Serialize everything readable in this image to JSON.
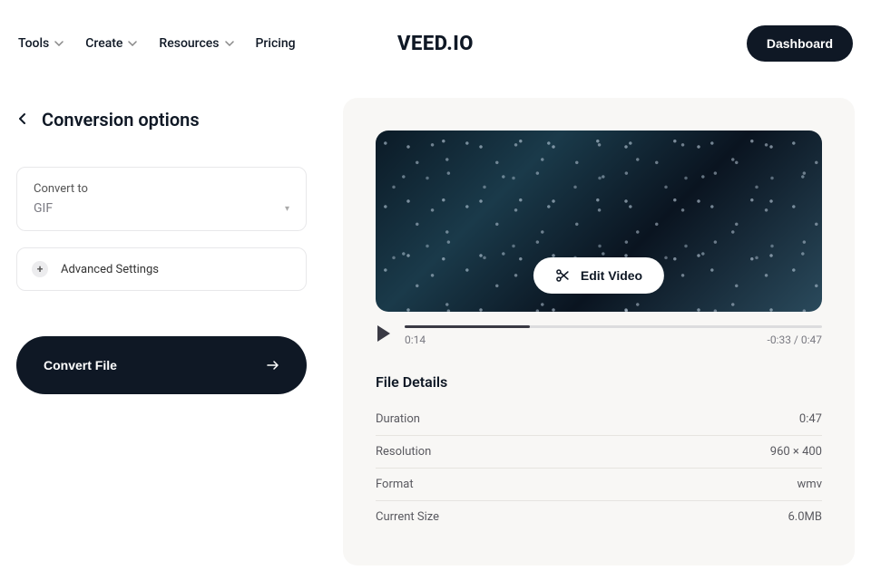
{
  "header": {
    "nav": [
      {
        "label": "Tools",
        "has_dropdown": true
      },
      {
        "label": "Create",
        "has_dropdown": true
      },
      {
        "label": "Resources",
        "has_dropdown": true
      },
      {
        "label": "Pricing",
        "has_dropdown": false
      }
    ],
    "logo": "VEED.IO",
    "dashboard_label": "Dashboard"
  },
  "left": {
    "page_title": "Conversion options",
    "convert_to_label": "Convert to",
    "convert_to_value": "GIF",
    "advanced_label": "Advanced Settings",
    "convert_button_label": "Convert File"
  },
  "right": {
    "edit_video_label": "Edit Video",
    "player": {
      "current_time": "0:14",
      "remaining_and_total": "-0:33 / 0:47",
      "progress_percent": 30
    },
    "details_title": "File Details",
    "details": [
      {
        "label": "Duration",
        "value": "0:47"
      },
      {
        "label": "Resolution",
        "value": "960 × 400"
      },
      {
        "label": "Format",
        "value": "wmv"
      },
      {
        "label": "Current Size",
        "value": "6.0MB"
      }
    ]
  }
}
